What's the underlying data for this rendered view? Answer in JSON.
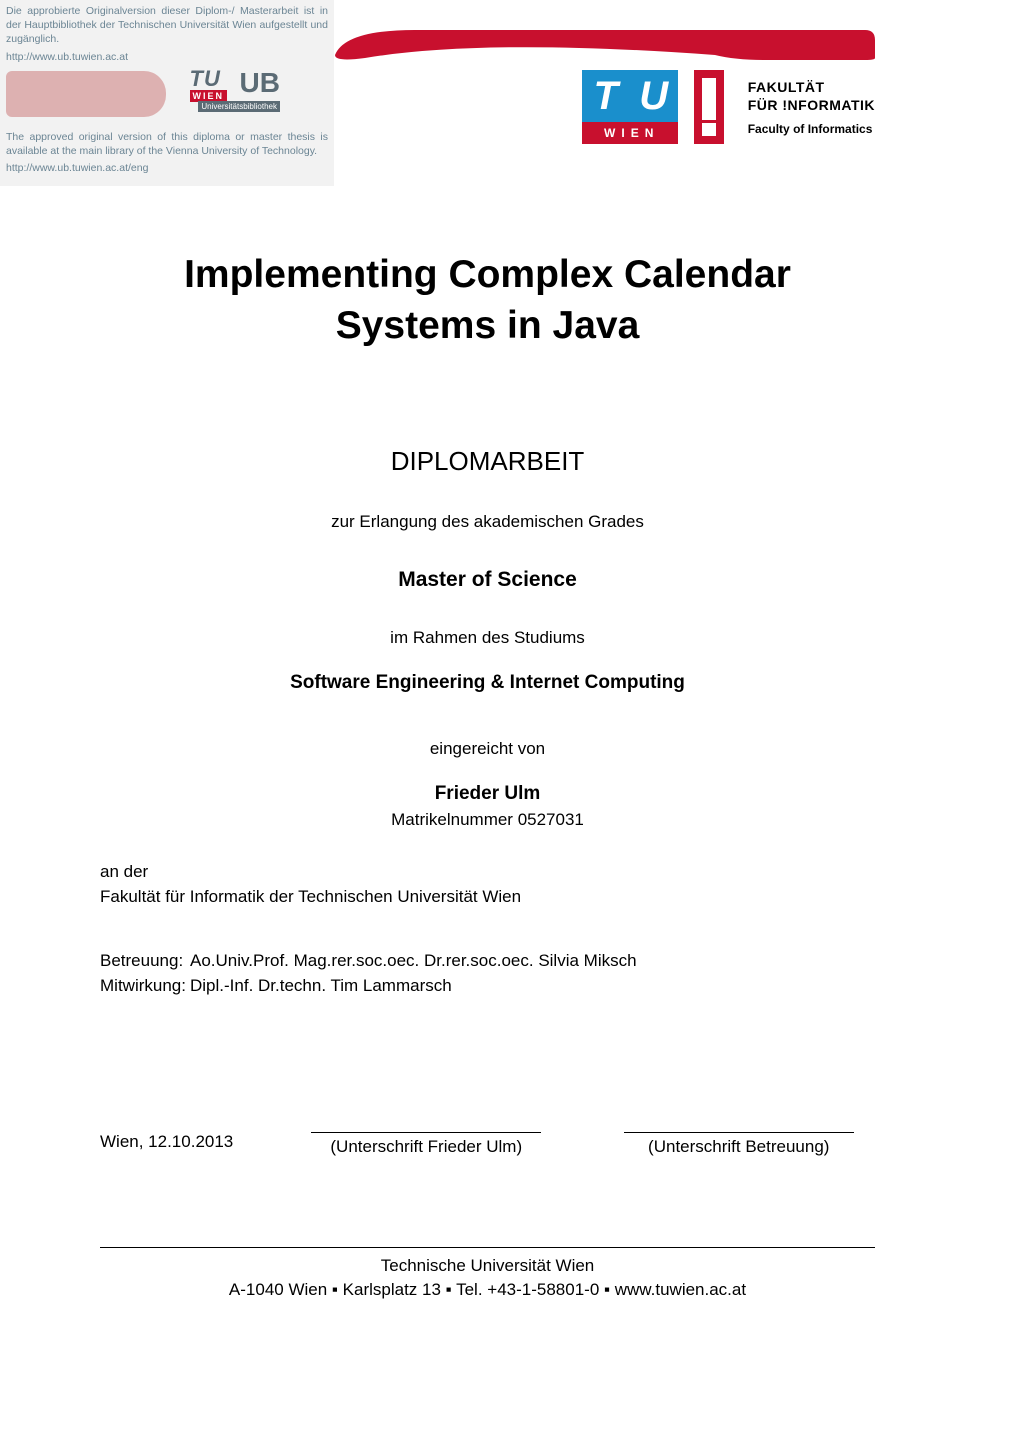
{
  "notice": {
    "de": "Die approbierte Originalversion dieser Diplom-/ Masterarbeit ist in der Hauptbibliothek der Technischen Universität Wien aufgestellt und zugänglich.",
    "link_de": "http://www.ub.tuwien.ac.at",
    "en": "The approved original version of this diploma or master thesis is available at the main library of the Vienna University of Technology.",
    "link_en": "http://www.ub.tuwien.ac.at/eng",
    "ub_label": "Universitätsbibliothek"
  },
  "logo": {
    "tu": "TU",
    "wien": "WIEN",
    "ub": "UB"
  },
  "faculty_header": {
    "de_line1": "FAKULTÄT",
    "de_line2": "FÜR !NFORMATIK",
    "en": "Faculty of Informatics"
  },
  "page": {
    "title": "Implementing Complex Calendar Systems in Java",
    "doc_type": "DIPLOMARBEIT",
    "purpose": "zur Erlangung des akademischen Grades",
    "degree": "Master of Science",
    "context": "im Rahmen des Studiums",
    "program": "Software Engineering & Internet Computing",
    "submitted_by": "eingereicht von",
    "author": "Frieder Ulm",
    "matric": "Matrikelnummer 0527031",
    "affiliation_intro": "an der",
    "affiliation": "Fakultät für Informatik der Technischen Universität Wien",
    "supervision_label": "Betreuung:",
    "supervisor": "Ao.Univ.Prof. Mag.rer.soc.oec. Dr.rer.soc.oec. Silvia Miksch",
    "assistance_label": "Mitwirkung:",
    "assistant": "Dipl.-Inf. Dr.techn. Tim Lammarsch",
    "place_date": "Wien, 12.10.2013",
    "sig_author": "(Unterschrift Frieder Ulm)",
    "sig_supervisor": "(Unterschrift Betreuung)"
  },
  "footer": {
    "line1": "Technische Universität Wien",
    "line2": "A-1040 Wien ▪ Karlsplatz 13 ▪ Tel. +43-1-58801-0 ▪ www.tuwien.ac.at"
  }
}
